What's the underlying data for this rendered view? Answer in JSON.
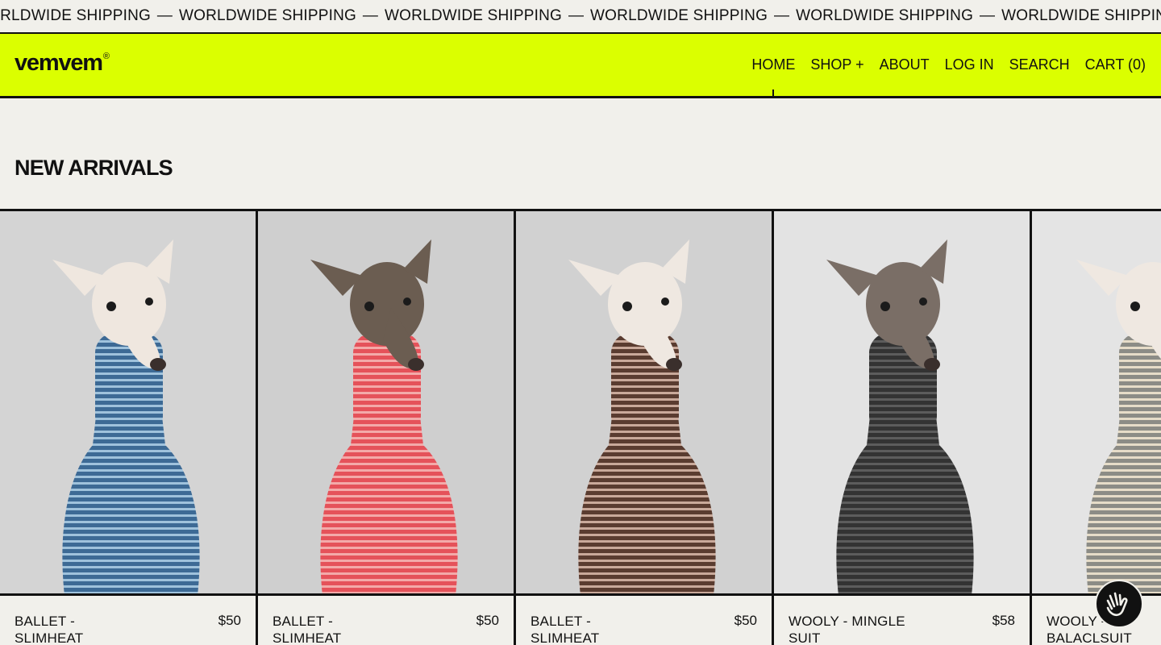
{
  "announcement": {
    "text": "WORLDWIDE SHIPPING",
    "separator": "—",
    "repeats": [
      "WORLDWIDE SHIPPING",
      "WORLDWIDE SHIPPING",
      "WORLDWIDE SHIPPING",
      "WORLDWIDE SHIPPING",
      "WORLDWIDE SHIPPING",
      "WORLDWIDE SHIPPING",
      "WORLDWIDE SHIPPING"
    ]
  },
  "header": {
    "logo": "vemvem",
    "logo_mark": "®",
    "nav": [
      {
        "label": "HOME",
        "active": true
      },
      {
        "label": "SHOP +"
      },
      {
        "label": "ABOUT"
      },
      {
        "label": "LOG IN"
      },
      {
        "label": "SEARCH"
      },
      {
        "label": "CART (0)"
      }
    ]
  },
  "main": {
    "section_title": "NEW ARRIVALS",
    "products": [
      {
        "name": "BALLET - SLIMHEAT",
        "price": "$50",
        "sweater_color": "#3d6a95",
        "stripe_color": "#9fc2dc",
        "dog_color": "#efe7df",
        "bg": "#d4d4d4"
      },
      {
        "name": "BALLET - SLIMHEAT",
        "price": "$50",
        "sweater_color": "#e5525a",
        "stripe_color": "#f3aaa9",
        "dog_color": "#6b5d51",
        "bg": "#cfcfcf"
      },
      {
        "name": "BALLET - SLIMHEAT",
        "price": "$50",
        "sweater_color": "#5a3c30",
        "stripe_color": "#c9a99a",
        "dog_color": "#efe8e1",
        "bg": "#d1d1d1"
      },
      {
        "name": "WOOLY - MINGLE SUIT",
        "price": "$58",
        "sweater_color": "#333333",
        "stripe_color": "#5c5c5c",
        "dog_color": "#7a6e66",
        "bg": "#e3e3e3"
      },
      {
        "name": "WOOLY - BALACLSUIT",
        "price": "",
        "sweater_color": "#8c8c86",
        "stripe_color": "#e6dcc8",
        "dog_color": "#efe8e1",
        "bg": "#e4e4e4"
      }
    ]
  },
  "chat": {
    "icon": "wave-hand-icon"
  }
}
